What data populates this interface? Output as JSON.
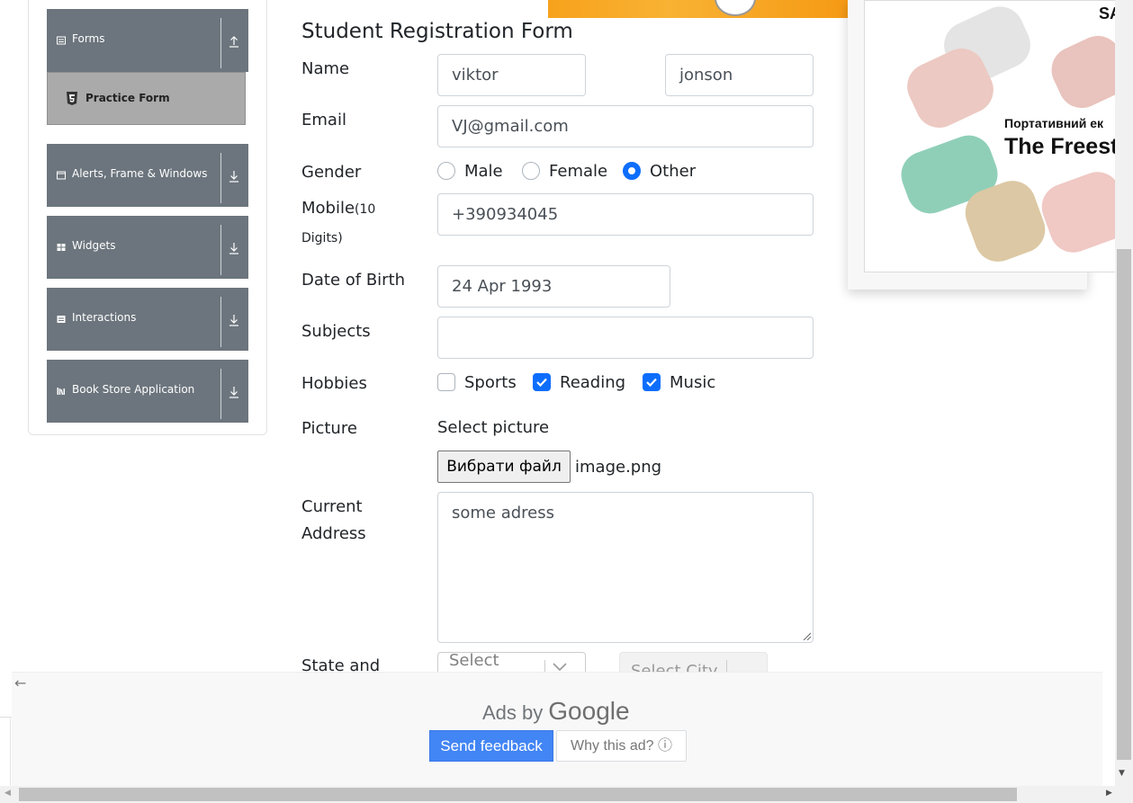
{
  "sidebar": {
    "groups": [
      {
        "label": "Forms",
        "icon": "list-icon",
        "arrow": "up-arrow-icon"
      },
      {
        "label": "Alerts, Frame & Windows",
        "icon": "window-icon",
        "arrow": "down-arrow-icon"
      },
      {
        "label": "Widgets",
        "icon": "grid-icon",
        "arrow": "down-arrow-icon"
      },
      {
        "label": "Interactions",
        "icon": "interaction-icon",
        "arrow": "down-arrow-icon"
      },
      {
        "label": "Book Store Application",
        "icon": "books-icon",
        "arrow": "down-arrow-icon"
      }
    ],
    "active_item": {
      "label": "Practice Form",
      "icon": "html5-icon"
    }
  },
  "form": {
    "title": "Student Registration Form",
    "name_label": "Name",
    "first_name": "viktor",
    "last_name": "jonson",
    "email_label": "Email",
    "email": "VJ@gmail.com",
    "gender_label": "Gender",
    "genders": [
      "Male",
      "Female",
      "Other"
    ],
    "gender_selected": "Other",
    "mobile_label": "Mobile",
    "mobile_hint": "(10",
    "mobile_hint2": "Digits)",
    "mobile": "+390934045",
    "dob_label": "Date of Birth",
    "dob": "24 Apr 1993",
    "subjects_label": "Subjects",
    "subjects_value": "",
    "hobbies_label": "Hobbies",
    "hobbies": [
      {
        "label": "Sports",
        "checked": false
      },
      {
        "label": "Reading",
        "checked": true
      },
      {
        "label": "Music",
        "checked": true
      }
    ],
    "picture_label": "Picture",
    "picture_prompt": "Select picture",
    "file_button": "Вибрати файл",
    "file_name": "image.png",
    "address_label_1": "Current",
    "address_label_2": "Address",
    "address": "some adress",
    "state_city_label": "State and",
    "state_placeholder": "Select",
    "city_placeholder": "Select City"
  },
  "ad_right": {
    "brand": "SA",
    "line1": "Портативний ек",
    "line2": "The Freest"
  },
  "ads_overlay": {
    "ads_by": "Ads by",
    "google": "Google",
    "send_feedback": "Send feedback",
    "why_this_ad": "Why this ad? ⓘ"
  },
  "colors": {
    "sidebar_group_bg": "#6c757d",
    "active_item_bg": "#aaaaaa",
    "accent": "#0d6efd",
    "feedback_button": "#4285f4"
  }
}
